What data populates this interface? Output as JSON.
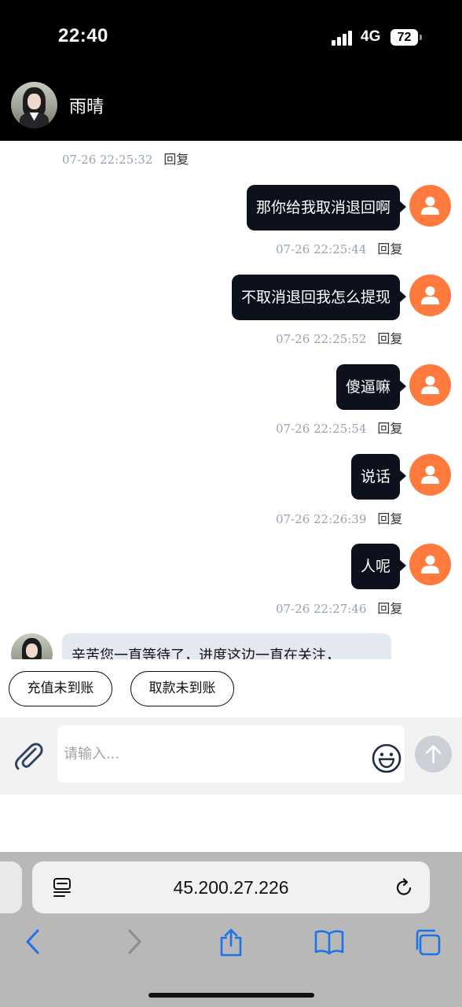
{
  "status_bar": {
    "time": "22:40",
    "network": "4G",
    "battery": "72"
  },
  "header": {
    "contact_name": "雨晴"
  },
  "chat": {
    "top_meta": {
      "timestamp": "07-26 22:25:32",
      "reply": "回复"
    },
    "outgoing": [
      {
        "text": "那你给我取消退回啊",
        "timestamp": "07-26 22:25:44",
        "reply": "回复"
      },
      {
        "text": "不取消退回我怎么提现",
        "timestamp": "07-26 22:25:52",
        "reply": "回复"
      },
      {
        "text": "傻逼嘛",
        "timestamp": "07-26 22:25:54",
        "reply": "回复"
      },
      {
        "text": "说话",
        "timestamp": "07-26 22:26:39",
        "reply": "回复"
      },
      {
        "text": "人呢",
        "timestamp": "07-26 22:27:46",
        "reply": "回复"
      }
    ],
    "incoming": {
      "text": "辛苦您一直等待了，进度这边一直在关注，"
    }
  },
  "quick_replies": [
    "充值未到账",
    "取款未到账"
  ],
  "composer": {
    "placeholder": "请输入..."
  },
  "browser": {
    "url": "45.200.27.226"
  },
  "colors": {
    "header_bg": "#000000",
    "user_avatar": "#ff7a3c",
    "bubble_dark": "#0c111d",
    "incoming_bubble": "#e4e9f1",
    "toolbar_blue": "#1a73e8"
  }
}
